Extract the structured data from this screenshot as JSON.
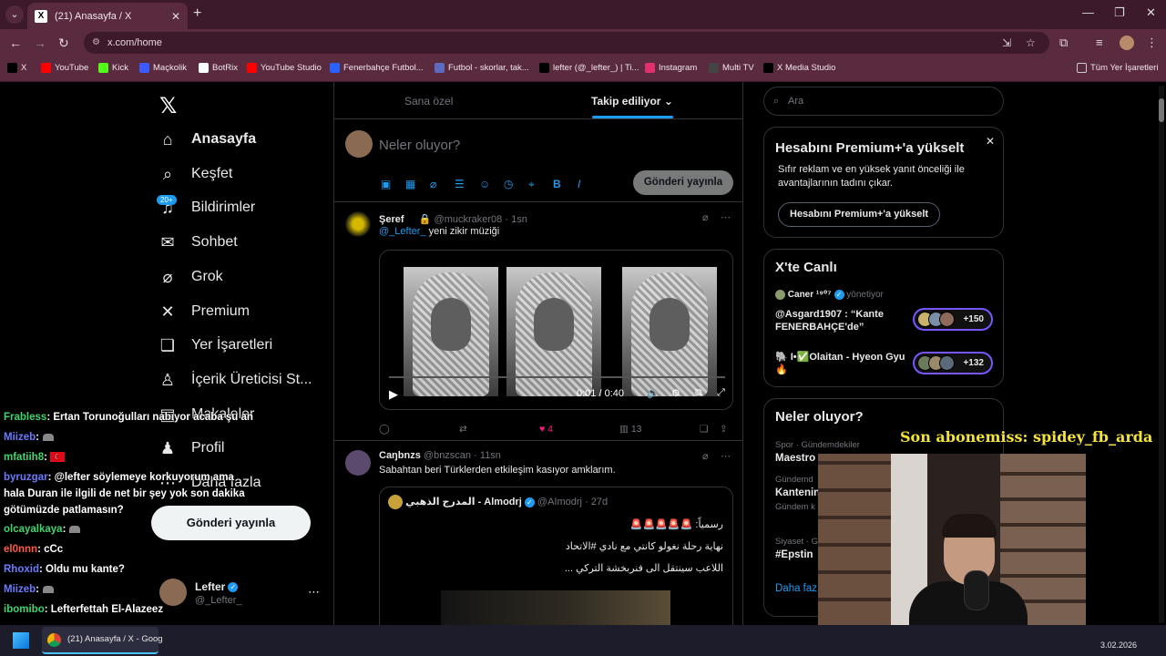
{
  "browser": {
    "tab_title": "(21) Anasayfa / X",
    "url": "x.com/home",
    "bookmarks": [
      {
        "label": "X",
        "icon": "x-icon",
        "color": "#000000"
      },
      {
        "label": "YouTube",
        "icon": "youtube-icon",
        "color": "#ff0000"
      },
      {
        "label": "Kick",
        "icon": "kick-icon",
        "color": "#53fc18"
      },
      {
        "label": "Maçkolik",
        "icon": "mackolik-icon",
        "color": "#3d5afe"
      },
      {
        "label": "BotRix",
        "icon": "botrix-icon",
        "color": "#ffffff"
      },
      {
        "label": "YouTube Studio",
        "icon": "youtube-studio-icon",
        "color": "#ff0000"
      },
      {
        "label": "Fenerbahçe Futbol...",
        "icon": "fenerbahce-icon",
        "color": "#2962ff"
      },
      {
        "label": "Futbol - skorlar, tak...",
        "icon": "flashscore-icon",
        "color": "#5c6bc0"
      },
      {
        "label": "lefter (@_lefter_) | Ti...",
        "icon": "tiktok-icon",
        "color": "#000000"
      },
      {
        "label": "Instagram",
        "icon": "instagram-icon",
        "color": "#e1306c"
      },
      {
        "label": "Multi TV",
        "icon": "multitv-icon",
        "color": "#444444"
      },
      {
        "label": "X Media Studio",
        "icon": "x-icon",
        "color": "#000000"
      }
    ],
    "all_bookmarks": "Tüm Yer İşaretleri"
  },
  "sidebar": {
    "badge": "20+",
    "items": [
      {
        "label": "Anasayfa",
        "icon": "home-icon",
        "glyph": "⌂"
      },
      {
        "label": "Keşfet",
        "icon": "search-icon",
        "glyph": "⌕"
      },
      {
        "label": "Bildirimler",
        "icon": "bell-icon",
        "glyph": "♫"
      },
      {
        "label": "Sohbet",
        "icon": "mail-icon",
        "glyph": "✉"
      },
      {
        "label": "Grok",
        "icon": "grok-icon",
        "glyph": "⌀"
      },
      {
        "label": "Premium",
        "icon": "x-icon",
        "glyph": "✕"
      },
      {
        "label": "Yer İşaretleri",
        "icon": "bookmark-icon",
        "glyph": "❏"
      },
      {
        "label": "İçerik Üreticisi St...",
        "icon": "creator-studio-icon",
        "glyph": "♙"
      },
      {
        "label": "Makaleler",
        "icon": "articles-icon",
        "glyph": "▤"
      },
      {
        "label": "Profil",
        "icon": "profile-icon",
        "glyph": "♟"
      },
      {
        "label": "Daha fazla",
        "icon": "more-icon",
        "glyph": "⋯"
      }
    ],
    "post_button": "Gönderi yayınla",
    "profile": {
      "name": "Lefter",
      "handle": "@_Lefter_"
    }
  },
  "timeline": {
    "tabs": [
      "Sana özel",
      "Takip ediliyor"
    ],
    "composer_placeholder": "Neler oluyor?",
    "composer_post": "Gönderi yayınla",
    "tweets": [
      {
        "name": "Şeref ㅤ",
        "handle": "@muckraker08",
        "time": "1sn",
        "mention": "@_Lefter_",
        "text": "yeni zikir müziği",
        "video_time": "0:01 / 0:40",
        "likes": "4",
        "views": "13"
      },
      {
        "name": "Caŋbnzs",
        "handle": "@bnzscan",
        "time": "11sn",
        "text": "Sabahtan beri Türklerden etkileşim kasıyor amklarım.",
        "quote": {
          "name": "المدرج الذهبي - Almodrj",
          "handle": "@AImodrj",
          "time": "27d",
          "lines": [
            "رسمياً: 🚨🚨🚨🚨🚨",
            "نهاية رحلة نغولو كانتي مع نادي #الاتحاد",
            "اللاعب سينتقل الى فنربخشة التركي ..."
          ]
        }
      }
    ]
  },
  "right": {
    "search_placeholder": "Ara",
    "premium": {
      "title": "Hesabını Premium+'a yükselt",
      "desc": "Sıfır reklam ve en yüksek yanıt önceliği ile avantajlarının tadını çıkar.",
      "button": "Hesabını Premium+'a yükselt"
    },
    "live": {
      "title": "X'te Canlı",
      "host": "Caner ¹⁹⁰⁷",
      "host_role": "yönetiyor",
      "spaces": [
        {
          "title": "@Asgard1907 : “Kante FENERBAHÇE'de”",
          "count": "+150"
        },
        {
          "title": "🐘 I•✅Olaitan - Hyeon Gyu 🔥",
          "count": "+132"
        }
      ]
    },
    "trends": {
      "title": "Neler oluyor?",
      "items": [
        {
          "meta": "Spor · Gündemdekiler",
          "name": "Maestro"
        },
        {
          "meta": "Gündemd",
          "name": "Kantenin"
        },
        {
          "meta": "Gündem k",
          "name": ""
        },
        {
          "meta": "Siyaset · G",
          "name": "#Epstin"
        }
      ],
      "more": "Daha faz"
    }
  },
  "stream": {
    "subscriber_banner": "Son abonemiss: spidey_fb_arda",
    "chat": [
      {
        "user": "Frabless",
        "color": "#3cd66c",
        "msg": ": Ertan Torunoğulları nabıyor acaba şu an"
      },
      {
        "user": "Miizeb",
        "color": "#6a7bff",
        "msg": ":",
        "hat": true
      },
      {
        "user": "mfatiih8",
        "color": "#3cd66c",
        "msg": ":",
        "flag": true
      },
      {
        "user": "byruzgar",
        "color": "#6a7bff",
        "msg": ": @lefter söylemeye korkuyorum ama"
      },
      {
        "user": "",
        "color": "#ffffff",
        "msg": "hala Duran ile ilgili de net bir şey yok son dakika"
      },
      {
        "user": "",
        "color": "#ffffff",
        "msg": "götümüzde patlamasın?"
      },
      {
        "user": "olcayalkaya",
        "color": "#3cd66c",
        "msg": ":",
        "hat": true
      },
      {
        "user": "el0nnn",
        "color": "#ff5a3c",
        "msg": ": cCc"
      },
      {
        "user": "Rhoxid",
        "color": "#6a7bff",
        "msg": ": Oldu mu kante?"
      },
      {
        "user": "Miizeb",
        "color": "#6a7bff",
        "msg": ":",
        "hat": true
      },
      {
        "user": "ibomibo",
        "color": "#3cd66c",
        "msg": ": Lefterfettah El-Alazeez"
      }
    ]
  },
  "taskbar": {
    "app_title": "(21) Anasayfa / X - Goog",
    "date": "3.02.2026"
  }
}
